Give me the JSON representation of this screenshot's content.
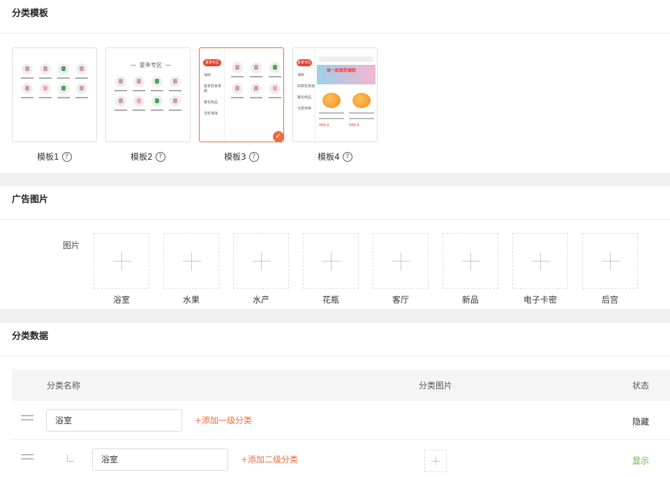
{
  "template_section": {
    "title": "分类模板",
    "templates": [
      {
        "label": "模板1",
        "selected": false
      },
      {
        "label": "模板2",
        "selected": false
      },
      {
        "label": "模板3",
        "selected": true
      },
      {
        "label": "模板4",
        "selected": false
      }
    ],
    "template2_heading": "夏季专区",
    "template3_sidebar": [
      "夏季专区",
      "海鲜",
      "夏季轻食果蔬",
      "餐包用品",
      "戈积海海"
    ],
    "template4_sidebar": [
      "夏季专区",
      "海鲜",
      "四季轻食蔬",
      "餐包用品",
      "当季用等"
    ],
    "template4_banner": "每一款都是爆款",
    "template4_prices": [
      "¥89.9",
      "¥89.9"
    ],
    "help_icon": "question-circle-icon",
    "selected_icon": "check-icon",
    "accent_color": "#f06a3c"
  },
  "ad_section": {
    "title": "广告图片",
    "image_label": "图片",
    "upload_icon": "plus-icon",
    "images": [
      "浴室",
      "水果",
      "水产",
      "花瓶",
      "客厅",
      "新品",
      "电子卡密",
      "后宫"
    ]
  },
  "data_section": {
    "title": "分类数据",
    "columns": {
      "name": "分类名称",
      "image": "分类图片",
      "status": "状态"
    },
    "rows": [
      {
        "name": "浴室",
        "action": "+添加一级分类",
        "status": "隐藏",
        "status_color": "#333333"
      },
      {
        "name": "浴室",
        "action": "+添加二级分类",
        "status": "显示",
        "status_color": "#52b035"
      }
    ]
  }
}
